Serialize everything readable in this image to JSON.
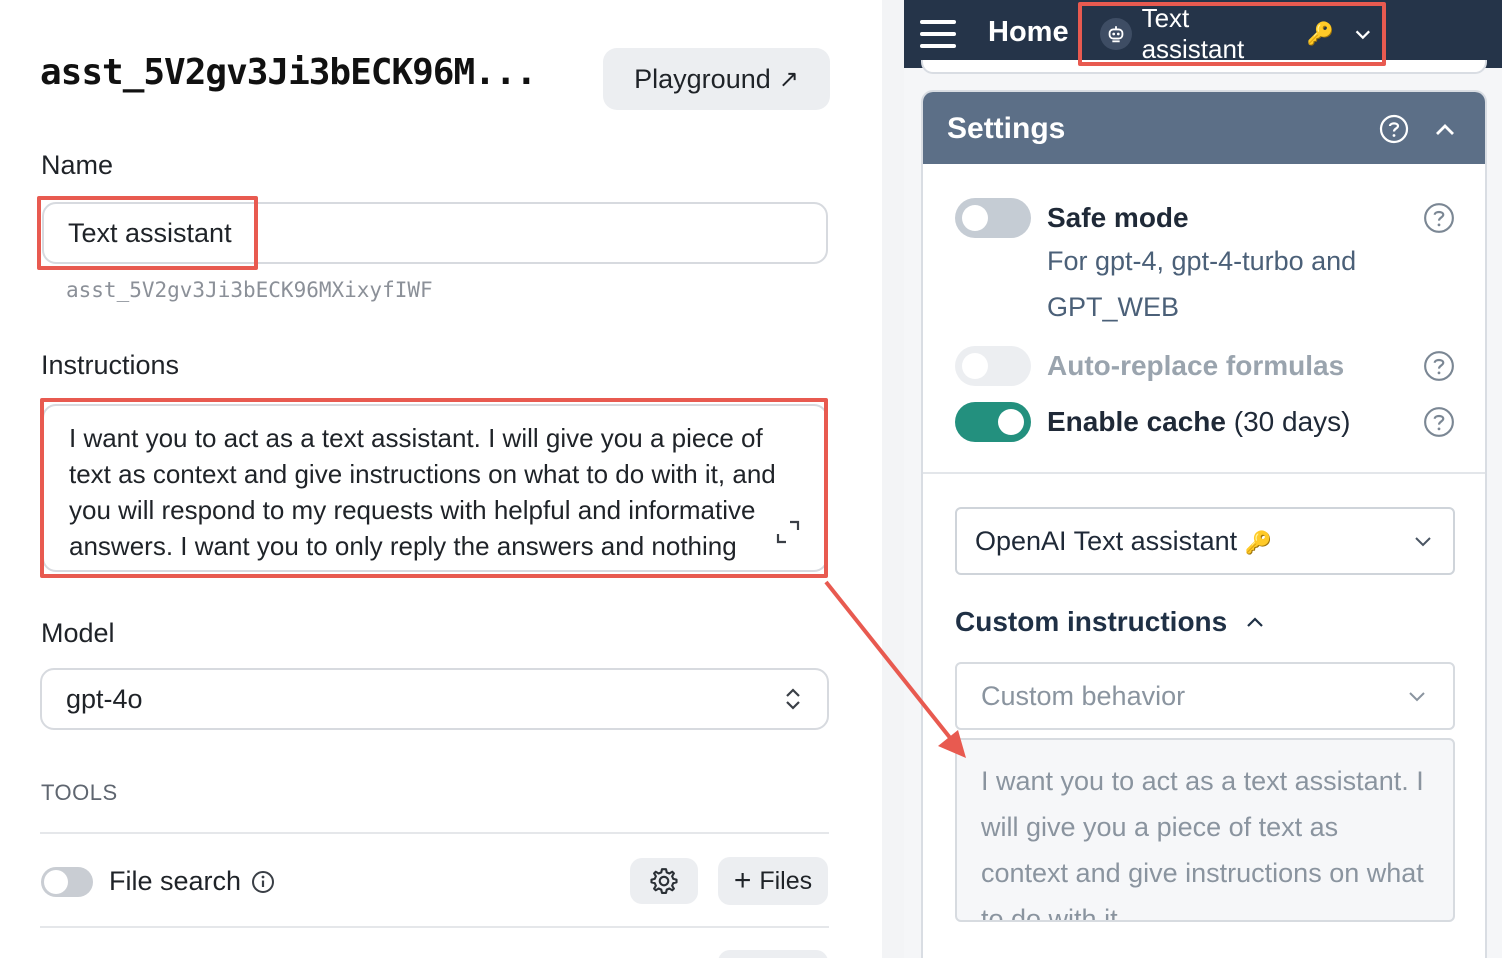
{
  "left": {
    "assistant_title": "asst_5V2gv3Ji3bECK96M...",
    "playground_label": "Playground",
    "name_label": "Name",
    "name_value": "Text assistant",
    "assistant_id": "asst_5V2gv3Ji3bECK96MXixyfIWF",
    "instructions_label": "Instructions",
    "instructions_text": "I want you to act as a text assistant. I will give you a piece of text as context and give instructions on what to do with it, and you will respond to my requests with helpful and informative answers. I want you to only reply the answers and nothing else, do not write explanations.",
    "model_label": "Model",
    "model_value": "gpt-4o",
    "tools_label": "TOOLS",
    "file_search_label": "File search",
    "files_button_label": "Files"
  },
  "right": {
    "home_label": "Home",
    "assistant_selector": "Text assistant",
    "settings_title": "Settings",
    "safe_mode": {
      "title": "Safe mode",
      "subtitle_line1": "For gpt-4, gpt-4-turbo and",
      "subtitle_line2": "GPT_WEB",
      "enabled": false
    },
    "auto_replace": {
      "title": "Auto-replace formulas",
      "enabled": false
    },
    "enable_cache": {
      "title": "Enable cache",
      "suffix": "(30 days)",
      "enabled": true
    },
    "model_dropdown": "OpenAI Text assistant",
    "custom_instructions_title": "Custom instructions",
    "custom_behavior_placeholder": "Custom behavior",
    "custom_instructions_text": "I want you to act as a text assistant. I will give you a piece of text as context and give instructions on what to do with it"
  },
  "colors": {
    "topbar": "#253449",
    "settings_header": "#5c6f87",
    "toggle_on": "#23907e",
    "toggle_off": "#c9cdd3",
    "highlight": "#e85a50"
  }
}
